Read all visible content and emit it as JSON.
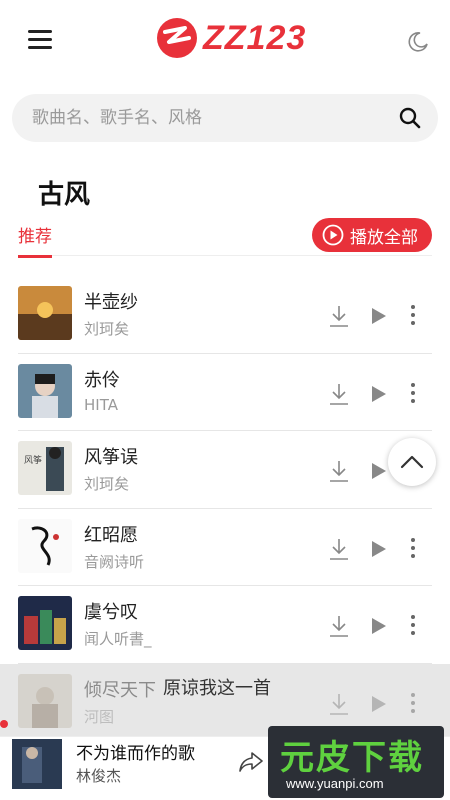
{
  "header": {
    "logo_text": "ZZ123"
  },
  "search": {
    "placeholder": "歌曲名、歌手名、风格"
  },
  "page": {
    "title": "古风"
  },
  "tabs": {
    "recommend": "推荐",
    "play_all": "播放全部"
  },
  "songs": [
    {
      "title": "半壶纱",
      "artist": "刘珂矣"
    },
    {
      "title": "赤伶",
      "artist": "HITA"
    },
    {
      "title": "风筝误",
      "artist": "刘珂矣"
    },
    {
      "title": "红昭愿",
      "artist": "音阙诗听"
    },
    {
      "title": "虞兮叹",
      "artist": "闻人听書_"
    },
    {
      "title": "倾尽天下",
      "artist": "河图"
    }
  ],
  "subtitle_overlay": "原谅我这一首",
  "player": {
    "title": "不为谁而作的歌",
    "artist": "林俊杰"
  },
  "watermark": {
    "main": "元皮下载",
    "url": "www.yuanpi.com"
  },
  "colors": {
    "accent": "#e8313a",
    "text": "#222222",
    "muted": "#9a9a9a"
  }
}
